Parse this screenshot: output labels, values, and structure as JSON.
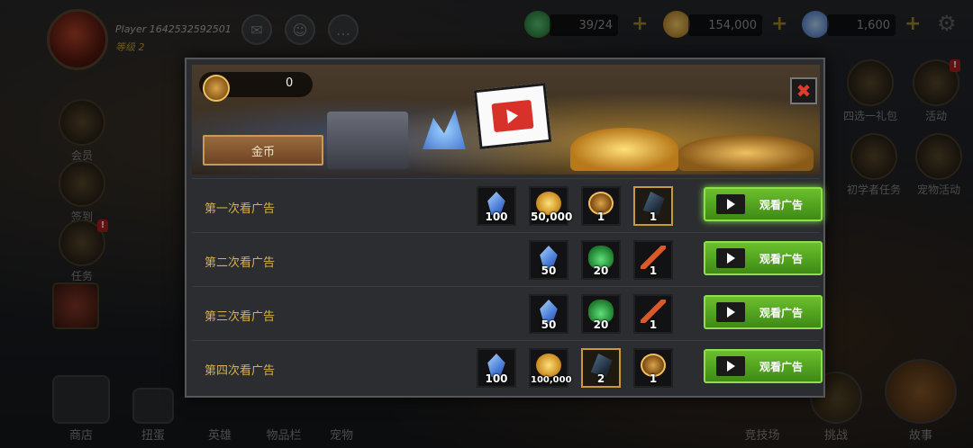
{
  "player": {
    "name": "Player 1642532592501",
    "level": "等级 2"
  },
  "resources": [
    {
      "icon": "energy-potion-icon",
      "value": "39/24"
    },
    {
      "icon": "gold-coin-icon",
      "value": "154,000"
    },
    {
      "icon": "crystal-icon",
      "value": "1,600"
    }
  ],
  "side_left": [
    {
      "label": "会员",
      "icon": "vip-badge-icon"
    },
    {
      "label": "签到",
      "icon": "scroll-icon"
    },
    {
      "label": "任务",
      "icon": "quest-icon",
      "badge": "!"
    }
  ],
  "side_right": [
    {
      "label": "四选一礼包",
      "icon": "gift-pack-icon"
    },
    {
      "label": "活动",
      "icon": "event-icon",
      "badge": "!"
    },
    {
      "label": "初学者任务",
      "icon": "beginner-quest-icon"
    },
    {
      "label": "宠物活动",
      "icon": "pet-event-icon"
    }
  ],
  "bottom_nav": [
    "商店",
    "扭蛋",
    "英雄",
    "物品栏",
    "宠物",
    "竞技场",
    "挑战",
    "故事"
  ],
  "modal": {
    "coin_value": "0",
    "gold_button": "金币",
    "close_symbol": "✖",
    "watch_label": "观看广告",
    "rows": [
      {
        "label": "第一次看广告",
        "rewards": [
          {
            "type": "crystal",
            "count": "100"
          },
          {
            "type": "gold",
            "count": "50,000"
          },
          {
            "type": "token",
            "count": "1"
          },
          {
            "type": "stone",
            "count": "1",
            "selected": true
          }
        ]
      },
      {
        "label": "第二次看广告",
        "rewards": [
          {
            "type": "crystal",
            "count": "50"
          },
          {
            "type": "potion",
            "count": "20"
          },
          {
            "type": "wand",
            "count": "1"
          }
        ]
      },
      {
        "label": "第三次看广告",
        "rewards": [
          {
            "type": "crystal",
            "count": "50"
          },
          {
            "type": "potion",
            "count": "20"
          },
          {
            "type": "wand",
            "count": "1"
          }
        ]
      },
      {
        "label": "第四次看广告",
        "rewards": [
          {
            "type": "crystal",
            "count": "100"
          },
          {
            "type": "gold",
            "count": "100,000"
          },
          {
            "type": "stone",
            "count": "2",
            "selected": true
          },
          {
            "type": "token",
            "count": "1"
          }
        ]
      }
    ]
  },
  "colors": {
    "accent_gold": "#d8b14a",
    "watch_green": "#5aa825",
    "close_red": "#e23a2e"
  }
}
